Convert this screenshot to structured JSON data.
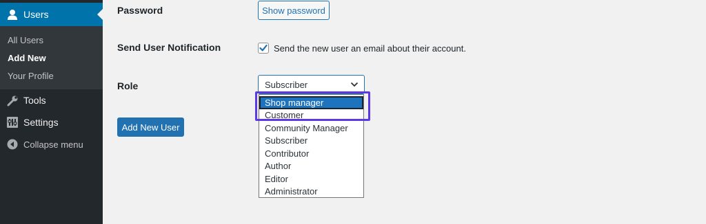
{
  "sidebar": {
    "current_menu": {
      "label": "Users",
      "icon": "user-icon"
    },
    "submenu": [
      {
        "label": "All Users",
        "current": false
      },
      {
        "label": "Add New",
        "current": true
      },
      {
        "label": "Your Profile",
        "current": false
      }
    ],
    "menu": [
      {
        "label": "Tools",
        "icon": "wrench-icon"
      },
      {
        "label": "Settings",
        "icon": "sliders-icon"
      },
      {
        "label": "Collapse menu",
        "icon": "collapse-arrow-icon"
      }
    ]
  },
  "form": {
    "password_label": "Password",
    "show_password_label": "Show password",
    "notification_label": "Send User Notification",
    "notification_checked": true,
    "notification_text": "Send the new user an email about their account.",
    "role_label": "Role",
    "role_selected": "Subscriber",
    "role_options": [
      "Shop manager",
      "Customer",
      "Community Manager",
      "Subscriber",
      "Contributor",
      "Author",
      "Editor",
      "Administrator"
    ],
    "highlighted_option": "Shop manager",
    "submit_label": "Add New User"
  },
  "colors": {
    "sidebar_bg": "#23282d",
    "accent": "#0073aa",
    "highlight_box": "#5b39e6"
  }
}
